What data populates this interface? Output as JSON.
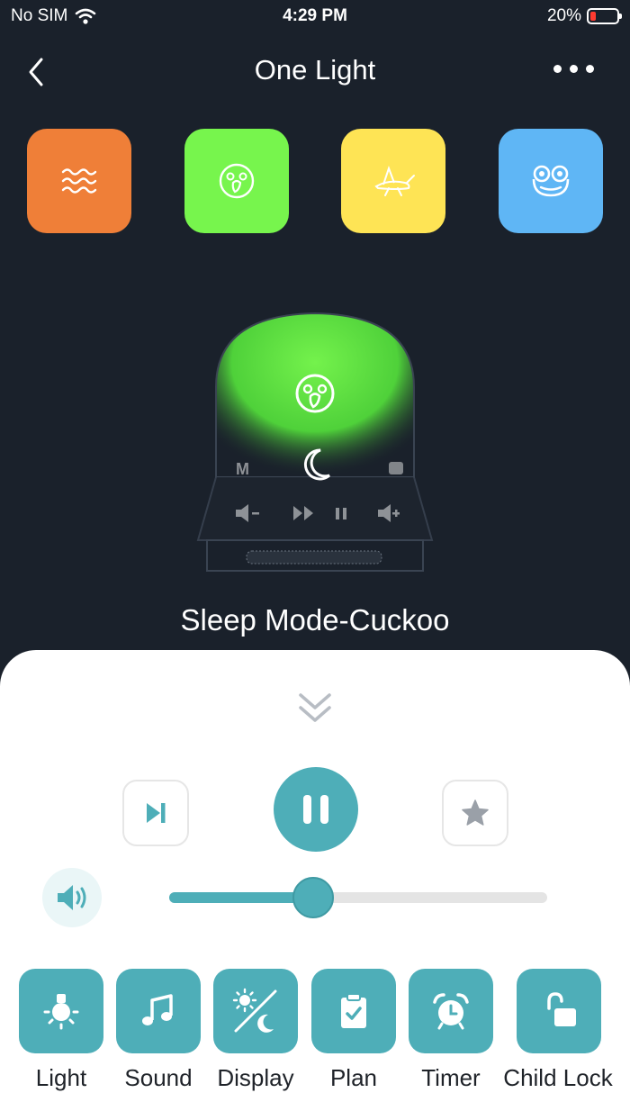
{
  "status_bar": {
    "carrier": "No SIM",
    "time": "4:29 PM",
    "battery_percent": "20%",
    "battery_level": 0.2
  },
  "nav": {
    "title": "One Light"
  },
  "modes": [
    {
      "icon": "waves-icon",
      "color": "#ef7f38"
    },
    {
      "icon": "parrot-icon",
      "color": "#77f54d"
    },
    {
      "icon": "cricket-icon",
      "color": "#fee455"
    },
    {
      "icon": "frog-icon",
      "color": "#5fb6f5"
    }
  ],
  "device": {
    "mode_letter": "M",
    "glow_color": "#6fe84a"
  },
  "now_playing": {
    "title": "Sleep Mode-Cuckoo"
  },
  "player": {
    "volume": 0.38
  },
  "functions": [
    {
      "label": "Light",
      "icon": "lamp-icon"
    },
    {
      "label": "Sound",
      "icon": "music-note-icon"
    },
    {
      "label": "Display",
      "icon": "sun-moon-icon"
    },
    {
      "label": "Plan",
      "icon": "clipboard-check-icon"
    },
    {
      "label": "Timer",
      "icon": "alarm-clock-icon"
    },
    {
      "label": "Child Lock",
      "icon": "unlock-icon"
    }
  ],
  "colors": {
    "accent": "#4eaeb8",
    "background": "#1a212b"
  }
}
